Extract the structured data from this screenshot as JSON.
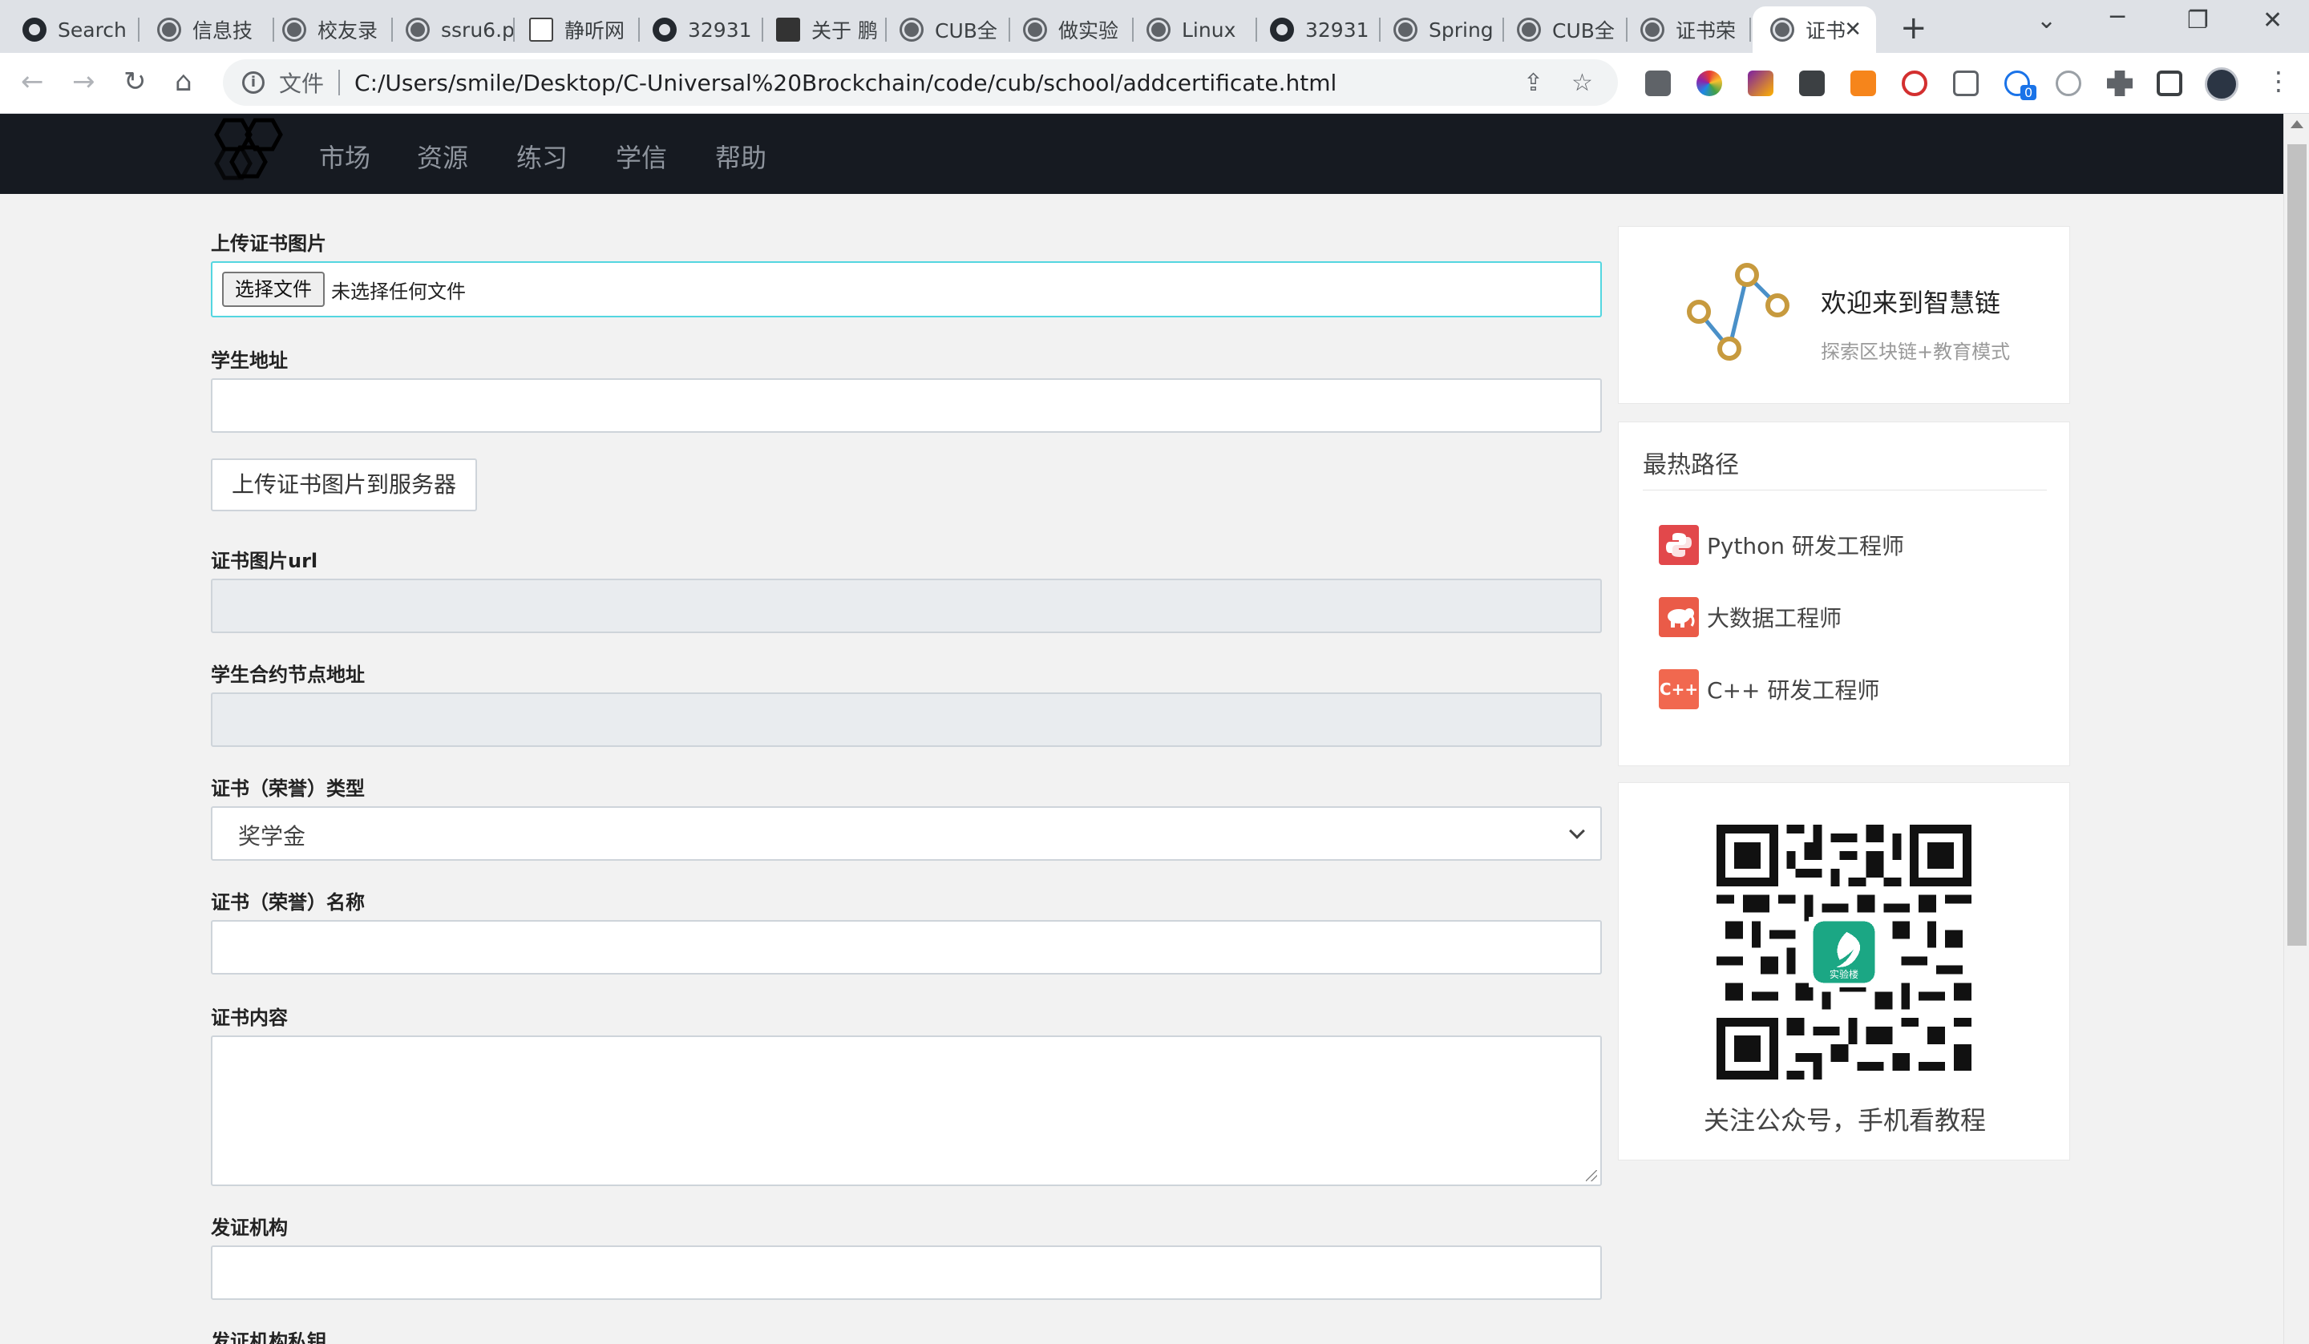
{
  "browser": {
    "tabs": [
      {
        "title": "Search",
        "icon": "github-icon"
      },
      {
        "title": "信息技",
        "icon": "globe-icon"
      },
      {
        "title": "校友录",
        "icon": "globe-icon"
      },
      {
        "title": "ssru6.p",
        "icon": "globe-icon"
      },
      {
        "title": "静听网",
        "icon": "seal-icon"
      },
      {
        "title": "32931",
        "icon": "github-icon"
      },
      {
        "title": "关于 鹏",
        "icon": "image-icon"
      },
      {
        "title": "CUB全",
        "icon": "globe-icon"
      },
      {
        "title": "做实验",
        "icon": "globe-icon"
      },
      {
        "title": "Linux",
        "icon": "globe-icon"
      },
      {
        "title": "32931",
        "icon": "github-icon"
      },
      {
        "title": "Spring",
        "icon": "globe-icon"
      },
      {
        "title": "CUB全",
        "icon": "globe-icon"
      },
      {
        "title": "证书荣",
        "icon": "globe-icon"
      },
      {
        "title": "证书",
        "icon": "globe-icon"
      }
    ],
    "address_label": "文件",
    "url": "C:/Users/smile/Desktop/C-Universal%20Brockchain/code/cub/school/addcertificate.html",
    "extension_badge": "0"
  },
  "site_nav": {
    "items": [
      "市场",
      "资源",
      "练习",
      "学信",
      "帮助"
    ]
  },
  "form": {
    "upload_image_label": "上传证书图片",
    "file_button": "选择文件",
    "file_status": "未选择任何文件",
    "student_address_label": "学生地址",
    "student_address_value": "",
    "upload_server_button": "上传证书图片到服务器",
    "image_url_label": "证书图片url",
    "image_url_value": "",
    "contract_node_label": "学生合约节点地址",
    "contract_node_value": "",
    "cert_type_label": "证书（荣誉）类型",
    "cert_type_value": "奖学金",
    "cert_name_label": "证书（荣誉）名称",
    "cert_name_value": "",
    "cert_content_label": "证书内容",
    "cert_content_value": "",
    "issuer_label": "发证机构",
    "issuer_value": "",
    "issuer_key_label": "发证机构私钥"
  },
  "sidebar": {
    "welcome_title": "欢迎来到智慧链",
    "welcome_subtitle": "探索区块链+教育模式",
    "popular_title": "最热路径",
    "paths": [
      {
        "label": "Python 研发工程师",
        "icon": "python-icon",
        "color": "#e2484b"
      },
      {
        "label": "大数据工程师",
        "icon": "hadoop-elephant-icon",
        "color": "#ea5b48"
      },
      {
        "label": "C++ 研发工程师",
        "icon": "cpp-icon",
        "color": "#f1684f",
        "glyph": "C++"
      }
    ],
    "qr_caption": "关注公众号，手机看教程",
    "qr_logo_text": "实验楼"
  }
}
